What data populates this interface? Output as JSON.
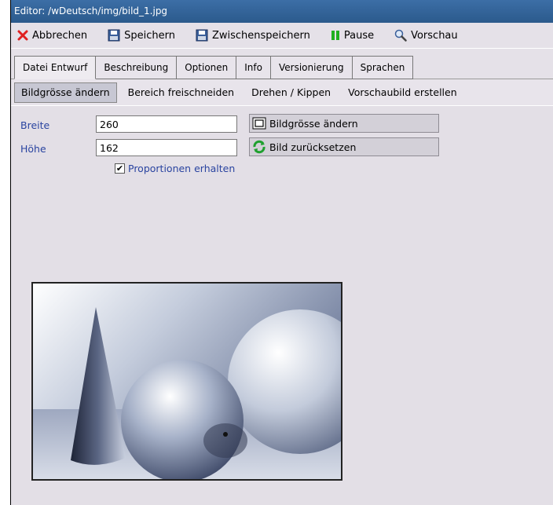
{
  "window": {
    "title": "Editor: /wDeutsch/img/bild_1.jpg"
  },
  "toolbar": {
    "cancel_label": "Abbrechen",
    "save_label": "Speichern",
    "save_temp_label": "Zwischenspeichern",
    "pause_label": "Pause",
    "preview_label": "Vorschau"
  },
  "tabs": [
    "Datei Entwurf",
    "Beschreibung",
    "Optionen",
    "Info",
    "Versionierung",
    "Sprachen"
  ],
  "subtabs": [
    "Bildgrösse ändern",
    "Bereich freischneiden",
    "Drehen / Kippen",
    "Vorschaubild erstellen"
  ],
  "form": {
    "width_label": "Breite",
    "width_value": "260",
    "height_label": "Höhe",
    "height_value": "162",
    "resize_button": "Bildgrösse ändern",
    "reset_button": "Bild zurücksetzen",
    "keep_proportions_label": "Proportionen erhalten",
    "keep_proportions_checked": true
  },
  "colors": {
    "title_bar": "#2b5a8c",
    "label_blue": "#2a44a0",
    "cancel_red": "#e02020",
    "pause_green": "#20b020"
  }
}
